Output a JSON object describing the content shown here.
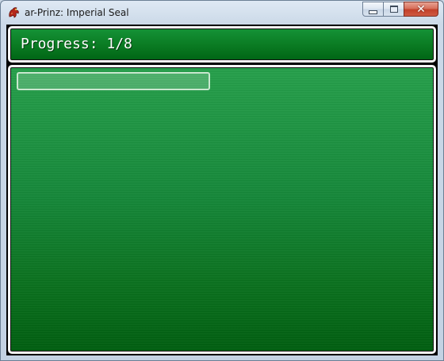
{
  "window": {
    "title": "ar-Prinz: Imperial Seal",
    "app_icon": "dragon-icon",
    "controls": {
      "minimize_icon": "minimize-icon",
      "maximize_icon": "maximize-icon",
      "close_icon": "close-icon",
      "close_glyph": "✕"
    }
  },
  "game": {
    "progress_text": "Progress: 1/8",
    "progress": {
      "current": 1,
      "total": 8
    },
    "colors": {
      "panel_green_top": "#26a04b",
      "panel_green_bottom": "#005e10",
      "panel_border": "#f4f4f4",
      "text": "#ffffff"
    }
  }
}
